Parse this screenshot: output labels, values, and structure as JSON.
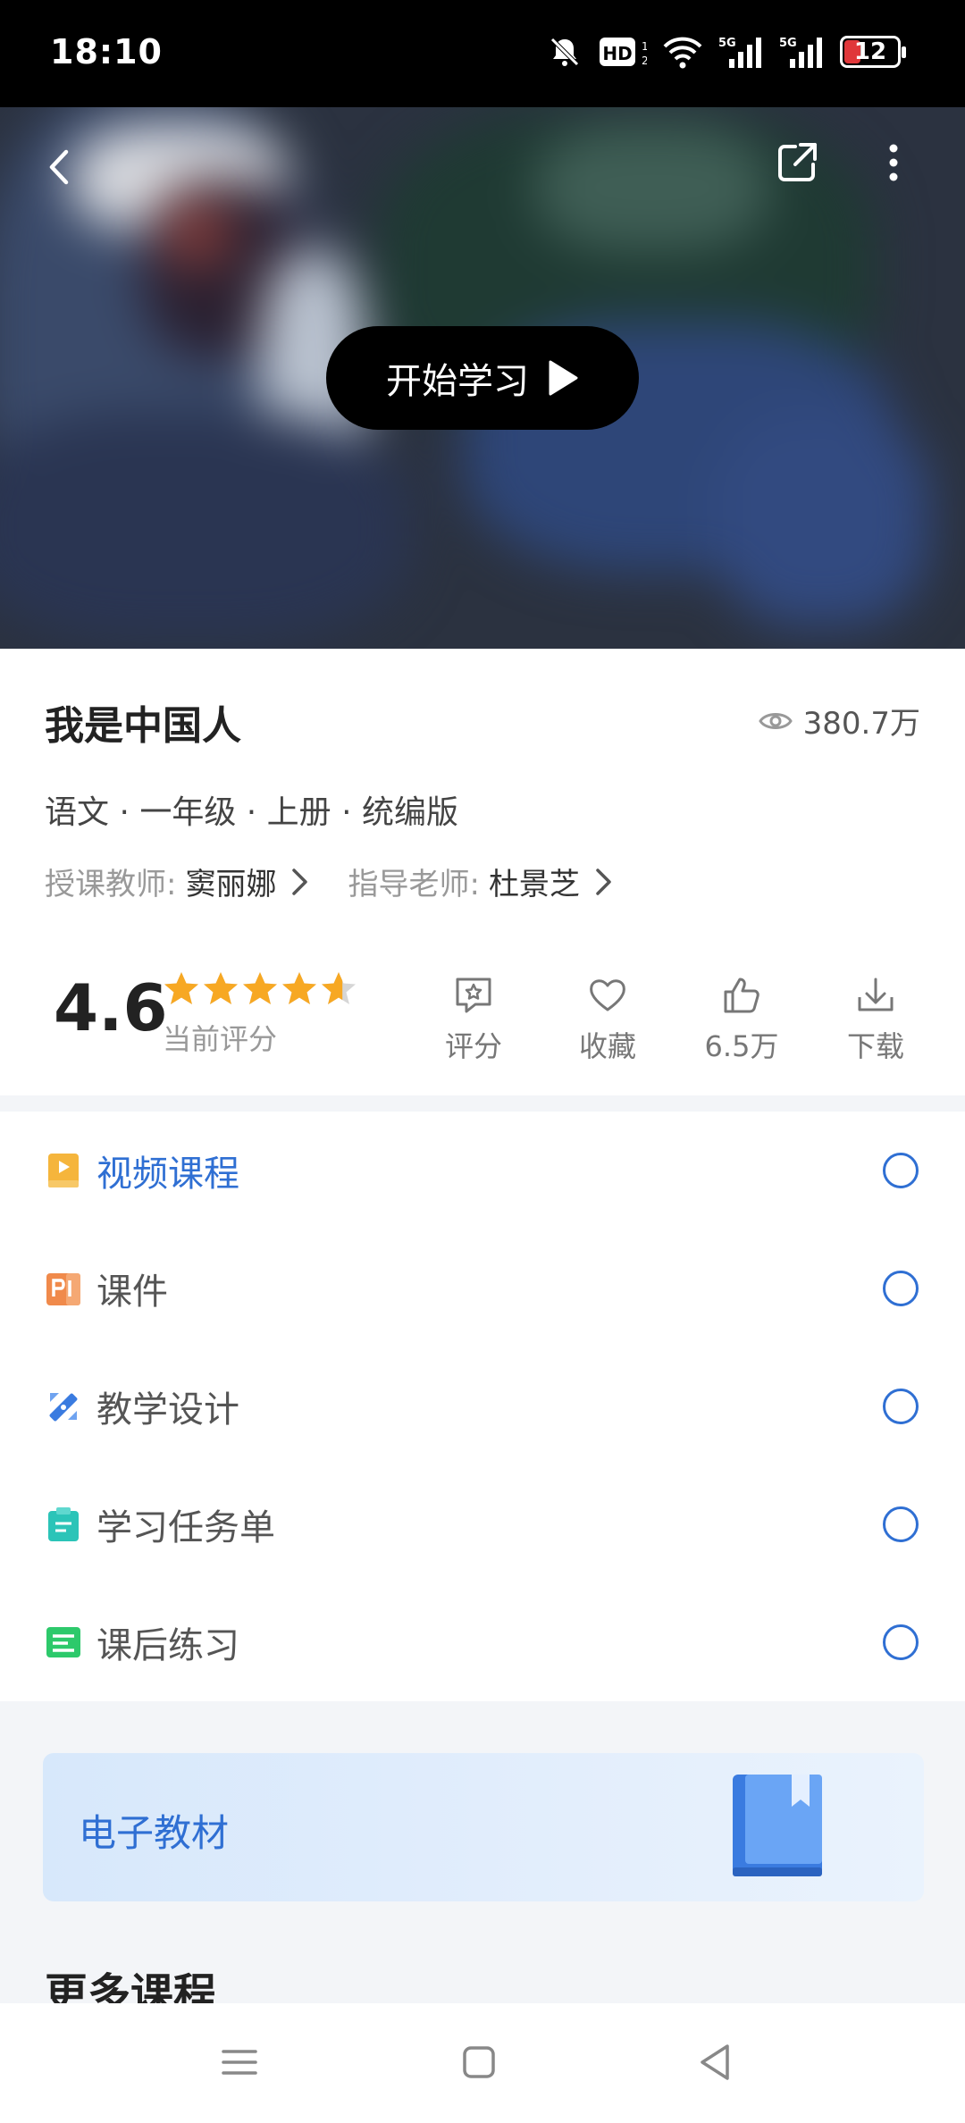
{
  "status_bar": {
    "time": "18:10",
    "battery": "12",
    "icons": [
      "mute-icon",
      "hd-icon",
      "wifi-icon",
      "signal-5g-icon",
      "signal-5g-icon",
      "battery-icon"
    ]
  },
  "video": {
    "start_label": "开始学习"
  },
  "course": {
    "title": "我是中国人",
    "views": "380.7万",
    "subject_line": "语文 · 一年级 · 上册 · 统编版",
    "teacher_label": "授课教师:",
    "teacher_name": "窦丽娜",
    "advisor_label": "指导老师:",
    "advisor_name": "杜景芝",
    "score": "4.6",
    "score_label": "当前评分",
    "stars": 4.6,
    "actions": {
      "rate": "评分",
      "favorite": "收藏",
      "likes": "6.5万",
      "download": "下载"
    }
  },
  "resources": [
    {
      "label": "视频课程",
      "icon": "video-course-icon",
      "color": "#f5b53c",
      "active": true
    },
    {
      "label": "课件",
      "icon": "courseware-icon",
      "color": "#f08a4b",
      "active": false
    },
    {
      "label": "教学设计",
      "icon": "teaching-design-icon",
      "color": "#3a7be0",
      "active": false
    },
    {
      "label": "学习任务单",
      "icon": "task-sheet-icon",
      "color": "#2bc4b8",
      "active": false
    },
    {
      "label": "课后练习",
      "icon": "exercise-icon",
      "color": "#2dc96b",
      "active": false
    }
  ],
  "ebook": {
    "label": "电子教材"
  },
  "more_courses": {
    "title": "更多课程"
  },
  "colors": {
    "accent": "#2f6fd3",
    "star": "#f7a823",
    "background": "#f3f5f8"
  }
}
